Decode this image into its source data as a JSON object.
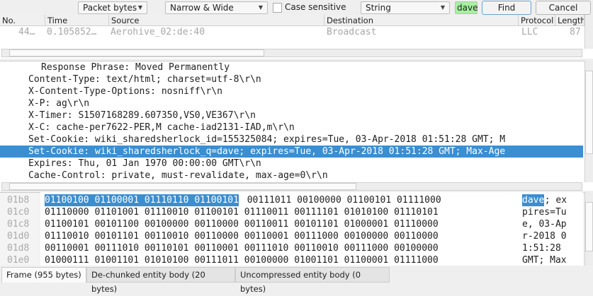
{
  "toolbar": {
    "search_in": "Packet bytes",
    "char_width": "Narrow & Wide",
    "case_sensitive_label": "Case sensitive",
    "case_sensitive": false,
    "search_type": "String",
    "search_value": "dave",
    "find_label": "Find",
    "cancel_label": "Cancel"
  },
  "packet_list": {
    "columns": [
      "No.",
      "Time",
      "Source",
      "Destination",
      "Protocol",
      "Length"
    ],
    "rows": [
      {
        "no": "44…",
        "time": "0.105852…",
        "source": "Aerohive_02:de:40",
        "destination": "Broadcast",
        "protocol": "LLC",
        "length": "87"
      }
    ]
  },
  "details": {
    "lines": [
      "Response Phrase: Moved Permanently",
      "Content-Type: text/html; charset=utf-8\\r\\n",
      "X-Content-Type-Options: nosniff\\r\\n",
      "X-P: ag\\r\\n",
      "X-Timer: S1507168289.607350,VS0,VE367\\r\\n",
      "X-C: cache-per7622-PER,M cache-iad2131-IAD,m\\r\\n",
      "Set-Cookie: wiki_sharedsherlock_id=155325084; expires=Tue, 03-Apr-2018 01:51:28 GMT; M",
      "Set-Cookie: wiki_sharedsherlock_q=dave; expires=Tue, 03-Apr-2018 01:51:28 GMT; Max-Age",
      "Expires: Thu, 01 Jan 1970 00:00:00 GMT\\r\\n",
      "Cache-Control: private, must-revalidate, max-age=0\\r\\n"
    ],
    "selected_index": 7
  },
  "bytes": {
    "rows": [
      {
        "offset": "01b8",
        "hl": "01100100 01100001 01110110 01100101",
        "bits": " 00111011 00100000 01100101 01111000",
        "ascii_hl": "dave",
        "ascii": "; ex"
      },
      {
        "offset": "01c0",
        "hl": "",
        "bits": "01110000 01101001 01110010 01100101 01110011 00111101 01010100 01110101",
        "ascii_hl": "",
        "ascii": "pires=Tu"
      },
      {
        "offset": "01c8",
        "hl": "",
        "bits": "01100101 00101100 00100000 00110000 00110011 00101101 01000001 01110000",
        "ascii_hl": "",
        "ascii": "e, 03-Ap"
      },
      {
        "offset": "01d0",
        "hl": "",
        "bits": "01110010 00101101 00110010 00110000 00110001 00111000 00100000 00110000",
        "ascii_hl": "",
        "ascii": "r-2018 0"
      },
      {
        "offset": "01d8",
        "hl": "",
        "bits": "00110001 00111010 00110101 00110001 00111010 00110010 00111000 00100000",
        "ascii_hl": "",
        "ascii": "1:51:28 "
      },
      {
        "offset": "01e0",
        "hl": "",
        "bits": "01000111 01001101 01010100 00111011 00100000 01001101 01100001 01111000",
        "ascii_hl": "",
        "ascii": "GMT; Max"
      }
    ]
  },
  "tabs": [
    "Frame (955 bytes)",
    "De-chunked entity body (20 bytes)",
    "Uncompressed entity body (0 bytes)"
  ],
  "colors": {
    "selection": "#3b8ed0",
    "search_ok": "#a6f0a0"
  }
}
